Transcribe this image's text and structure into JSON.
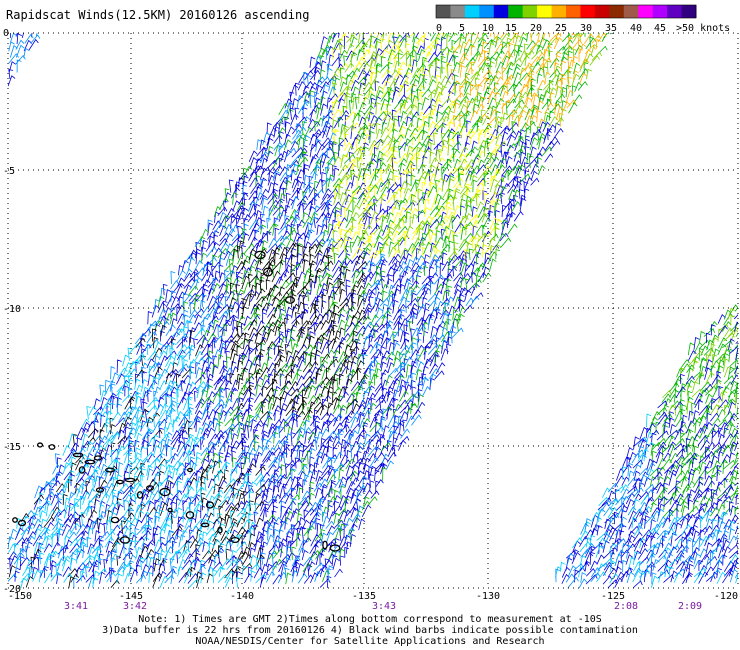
{
  "title": "Rapidscat Winds(12.5KM) 20160126 ascending",
  "color_scale": {
    "labels": [
      "0",
      "5",
      "10",
      "15",
      "20",
      "25",
      "30",
      "35",
      "40",
      "45",
      ">50 knots"
    ],
    "colors": [
      "#555555",
      "#8a8a8a",
      "#00cfff",
      "#0090ff",
      "#0000e0",
      "#00b400",
      "#7fd200",
      "#ffff00",
      "#ffb000",
      "#ff6000",
      "#ff0000",
      "#c80000",
      "#8b2a00",
      "#a05a4a",
      "#ff00ff",
      "#b000ff",
      "#6000c0",
      "#300080"
    ]
  },
  "latitude_labels": [
    "0",
    "-5",
    "-10",
    "-15",
    "-20"
  ],
  "longitude_labels": [
    "-150",
    "-145",
    "-140",
    "-135",
    "-130",
    "-125",
    "-120"
  ],
  "time_labels": [
    "3:41",
    "3:42",
    "3:43",
    "2:08",
    "2:09"
  ],
  "notes": [
    "Note: 1) Times are GMT 2)Times along bottom correspond to measurement at -10S",
    "3)Data buffer is 22 hrs from 20160126 4) Black wind barbs indicate possible contamination",
    "NOAA/NESDIS/Center for Satellite Applications and Research"
  ]
}
